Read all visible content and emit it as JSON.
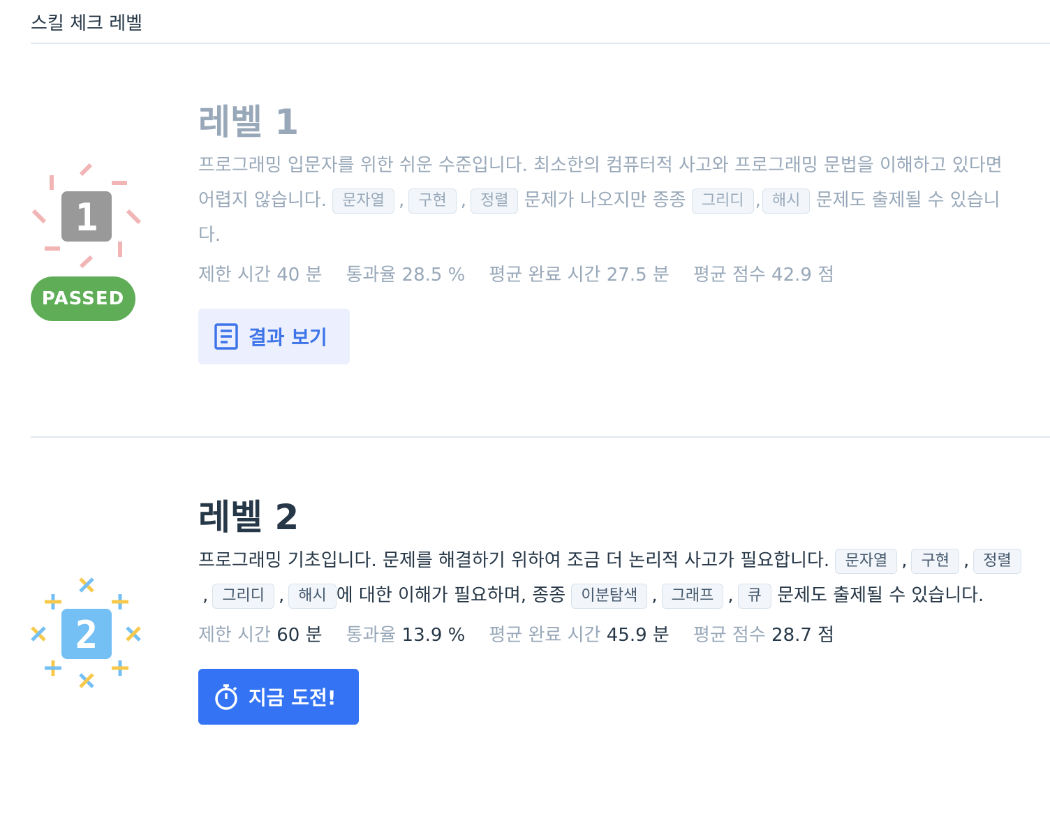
{
  "header": {
    "title": "스킬 체크 레벨"
  },
  "levels": [
    {
      "badge_number": "1",
      "status": "PASSED",
      "title": "레벨 1",
      "desc_before": "프로그래밍 입문자를 위한 쉬운 수준입니다. 최소한의 컴퓨터적 사고와 프로그래밍 문법을 이해하고 있다면 어렵지 않습니다.",
      "tags_a": [
        "문자열",
        "구현",
        "정렬"
      ],
      "desc_middle": "문제가 나오지만 종종",
      "tags_b": [
        "그리디",
        "해시"
      ],
      "desc_after": "문제도 출제될 수 있습니다.",
      "stats": [
        {
          "label": "제한 시간",
          "value": "40 분"
        },
        {
          "label": "통과율",
          "value": "28.5 %"
        },
        {
          "label": "평균 완료 시간",
          "value": "27.5 분"
        },
        {
          "label": "평균 점수",
          "value": "42.9 점"
        }
      ],
      "button_label": "결과 보기",
      "button_icon": "document-icon",
      "accent_color": "#f2b5b5"
    },
    {
      "badge_number": "2",
      "title": "레벨 2",
      "desc_before": "프로그래밍 기초입니다. 문제를 해결하기 위하여 조금 더 논리적 사고가 필요합니다.",
      "tags_a": [
        "문자열",
        "구현",
        "정렬",
        "그리디",
        "해시"
      ],
      "desc_middle": "에 대한 이해가 필요하며, 종종",
      "tags_b": [
        "이분탐색",
        "그래프",
        "큐"
      ],
      "desc_after": "문제도 출제될 수 있습니다.",
      "stats": [
        {
          "label": "제한 시간",
          "value": "60 분"
        },
        {
          "label": "통과율",
          "value": "13.9 %"
        },
        {
          "label": "평균 완료 시간",
          "value": "45.9 분"
        },
        {
          "label": "평균 점수",
          "value": "28.7 점"
        }
      ],
      "button_label": "지금 도전!",
      "button_icon": "stopwatch-icon",
      "accent_color": "#74c0f4"
    }
  ]
}
